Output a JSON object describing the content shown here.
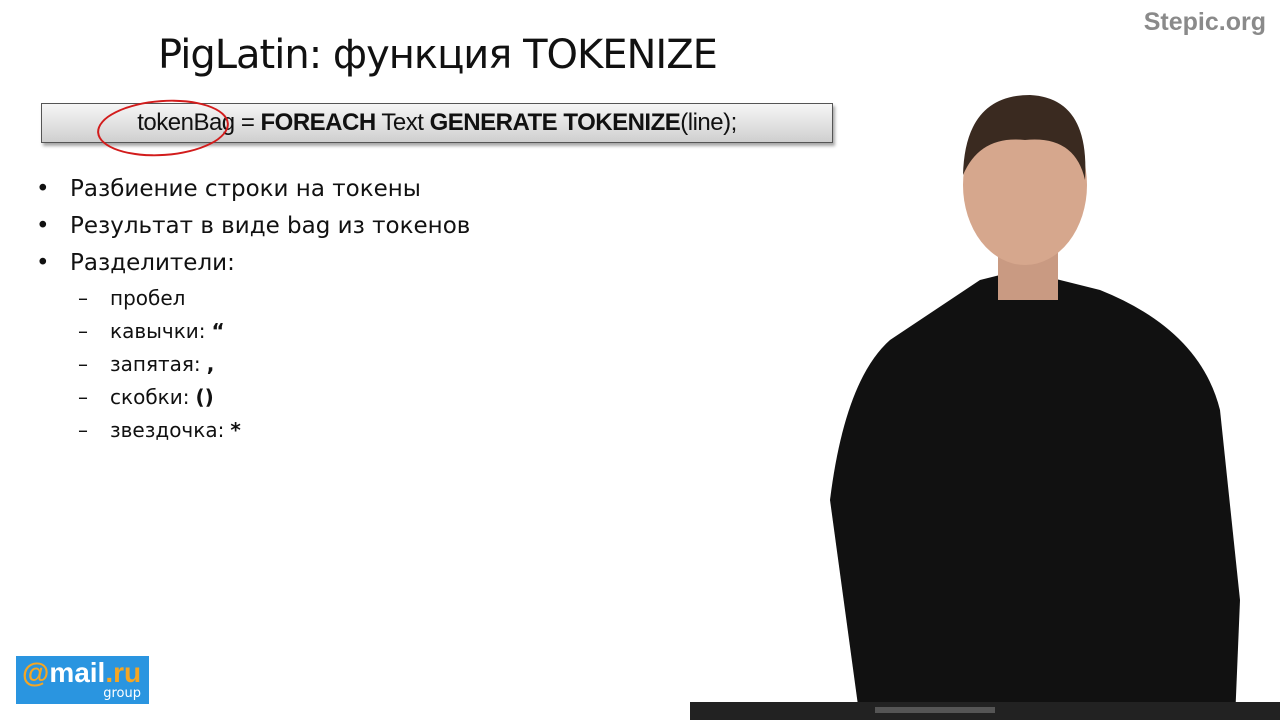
{
  "slide": {
    "title": "PigLatin: функция TOKENIZE",
    "code": {
      "var": "tokenBag",
      "eq": " = ",
      "kw1": "FOREACH",
      "t1": " Text ",
      "kw2": "GENERATE TOKENIZE",
      "t2": "(line);"
    },
    "bullets": [
      "Разбиение строки на токены",
      "Результат в виде bag из токенов",
      "Разделители:"
    ],
    "sub_items": [
      {
        "label": "пробел",
        "symbol": ""
      },
      {
        "label": "кавычки:",
        "symbol": "“"
      },
      {
        "label": "запятая:",
        "symbol": ","
      },
      {
        "label": "скобки:",
        "symbol": "()"
      },
      {
        "label": "звездочка:",
        "symbol": "*"
      }
    ],
    "bullet_glyph": "•",
    "dash_glyph": "–"
  },
  "watermark": "Stepic.org",
  "logo": {
    "at": "@",
    "name": "mail",
    "dot_ru": ".ru",
    "group": "group"
  },
  "colors": {
    "logo_bg": "#2a95e0",
    "logo_accent": "#f5a623",
    "annotation": "#d21c1c"
  }
}
